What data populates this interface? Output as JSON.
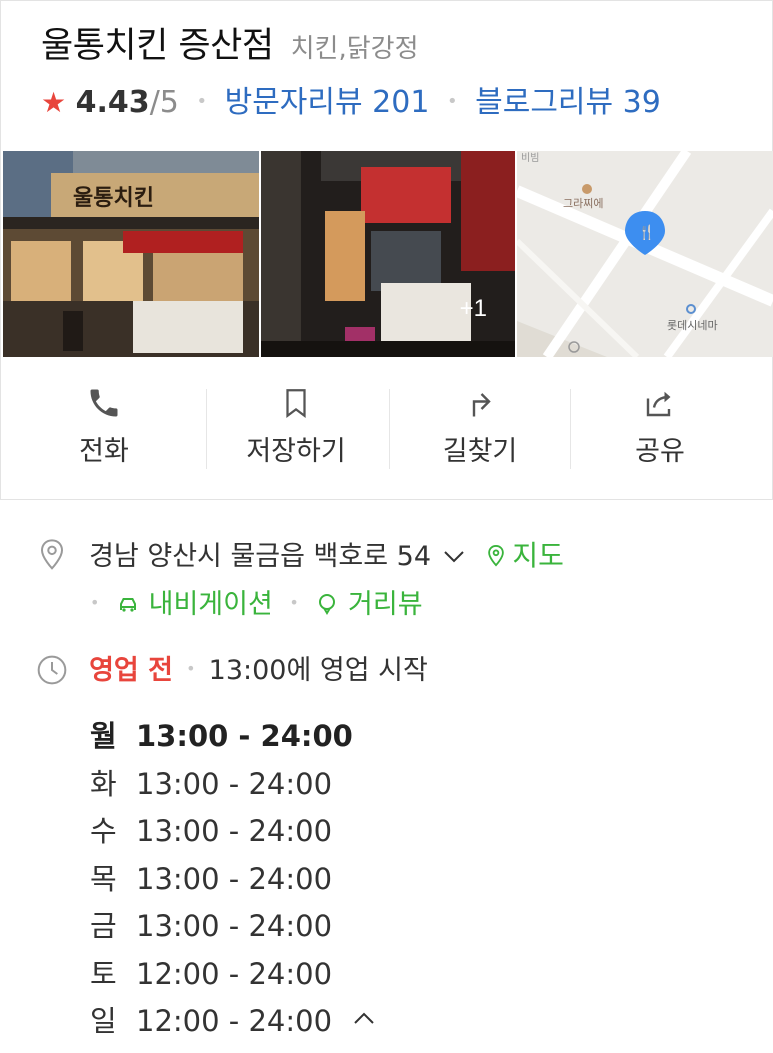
{
  "place": {
    "name": "울통치킨 증산점",
    "category": "치킨,닭강정",
    "rating": "4.43",
    "rating_max": "/5",
    "visitor_reviews": "방문자리뷰 201",
    "blog_reviews": "블로그리뷰 39"
  },
  "photos": {
    "more_count": "+1",
    "sign_text": "울통치킨",
    "map_labels": [
      "비빔",
      "그라찌에",
      "롯데시네마"
    ]
  },
  "actions": [
    {
      "label": "전화",
      "icon": "phone-icon"
    },
    {
      "label": "저장하기",
      "icon": "bookmark-icon"
    },
    {
      "label": "길찾기",
      "icon": "directions-icon"
    },
    {
      "label": "공유",
      "icon": "share-icon"
    }
  ],
  "address": {
    "text": "경남 양산시 물금읍 백호로 54",
    "map_link": "지도",
    "navigation_link": "내비게이션",
    "streetview_link": "거리뷰"
  },
  "business_hours": {
    "status": "영업 전",
    "open_info": "13:00에 영업 시작",
    "days": [
      {
        "day": "월",
        "hours": "13:00 - 24:00",
        "today": true
      },
      {
        "day": "화",
        "hours": "13:00 - 24:00"
      },
      {
        "day": "수",
        "hours": "13:00 - 24:00"
      },
      {
        "day": "목",
        "hours": "13:00 - 24:00"
      },
      {
        "day": "금",
        "hours": "13:00 - 24:00"
      },
      {
        "day": "토",
        "hours": "12:00 - 24:00"
      },
      {
        "day": "일",
        "hours": "12:00 - 24:00"
      }
    ]
  },
  "colors": {
    "star": "#e8453c",
    "link_blue": "#2e6cc0",
    "link_green": "#3ab43c",
    "status_red": "#e8453c"
  }
}
